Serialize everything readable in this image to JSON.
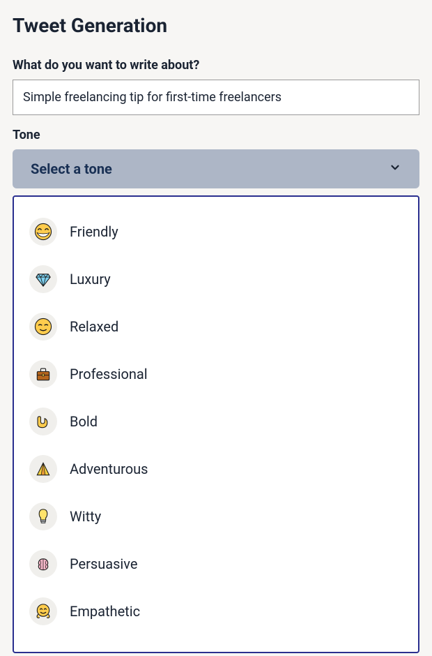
{
  "title": "Tweet Generation",
  "topic": {
    "label": "What do you want to write about?",
    "value": "Simple freelancing tip for first-time freelancers"
  },
  "tone": {
    "label": "Tone",
    "placeholder": "Select a tone",
    "options": [
      {
        "icon": "friendly",
        "label": "Friendly"
      },
      {
        "icon": "luxury",
        "label": "Luxury"
      },
      {
        "icon": "relaxed",
        "label": "Relaxed"
      },
      {
        "icon": "professional",
        "label": "Professional"
      },
      {
        "icon": "bold",
        "label": "Bold"
      },
      {
        "icon": "adventurous",
        "label": "Adventurous"
      },
      {
        "icon": "witty",
        "label": "Witty"
      },
      {
        "icon": "persuasive",
        "label": "Persuasive"
      },
      {
        "icon": "empathetic",
        "label": "Empathetic"
      }
    ]
  }
}
